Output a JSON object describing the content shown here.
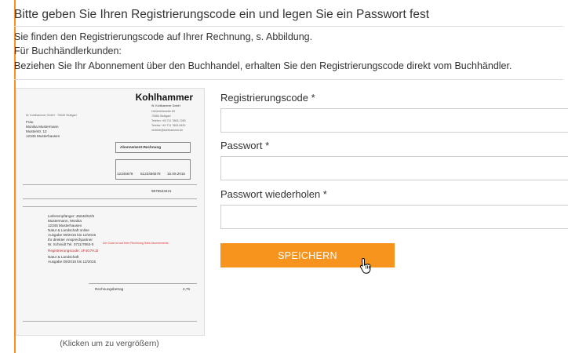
{
  "header": {
    "title": "Bitte geben Sie Ihren Registrierungscode ein und legen Sie ein Passwort fest",
    "info_line1": "Sie finden den Registrierungscode auf Ihrer Rechnung, s. Abbildung.",
    "info_line2": "Für Buchhändlerkunden:",
    "info_line3": "Beziehen Sie Ihr Abonnement über den Buchhandel, erhalten Sie den Registrierungscode direkt vom Buchhändler."
  },
  "invoice": {
    "logo": "Kohlhammer",
    "publisher": "W. Kohlhammer GmbH",
    "addr_lines": [
      "Heßbrühlstraße 69",
      "70565 Stuttgart",
      "Telefon +49 711 7863-7280",
      "Telefax +49 711 7863-8430",
      "vertrieb@kohlhammer.de"
    ],
    "sender_line": "W. Kohlhammer GmbH · 70549 Stuttgart",
    "recipient": [
      "Frau",
      "Monika Mustermann",
      "Musterstr. 12",
      "12345 Musterhausen"
    ],
    "invoice_title": "Abonnement-Rechnung",
    "invoice_numbers": [
      "12345678",
      "5123456578",
      "15.09.2015"
    ],
    "order_no": "9876543421",
    "items": [
      "Lieferempfänger: 45646/52/5",
      "Mustermann, Monika",
      "12345 Musterhausen",
      "Natur & Landschaft online",
      "Ausgabe 09/2015 bis 12/2015",
      "Ihr direkter Ansprechpartner",
      "W. Schmidt Tel. 0711/7863-0",
      "Registrierungscode: 1F4G7HJ2",
      "Natur & Landschaft",
      "Ausgabe 09/2015 bis 12/2015"
    ],
    "note": "Der Code ist auf Ihrer Rechnung Ihres Abonnements",
    "total_label": "Rechnungsbetrag",
    "total_value": "2,79"
  },
  "caption": "(Klicken um zu vergrößern)",
  "form": {
    "code_label": "Registrierungscode *",
    "code_value": "",
    "password_label": "Passwort *",
    "password_value": "",
    "password_repeat_label": "Passwort wiederholen *",
    "password_repeat_value": "",
    "save_label": "SPEICHERN"
  },
  "colors": {
    "accent": "#f7941d",
    "border": "#cfcfcf"
  },
  "icons": {
    "cursor": "hand-pointer-icon"
  }
}
